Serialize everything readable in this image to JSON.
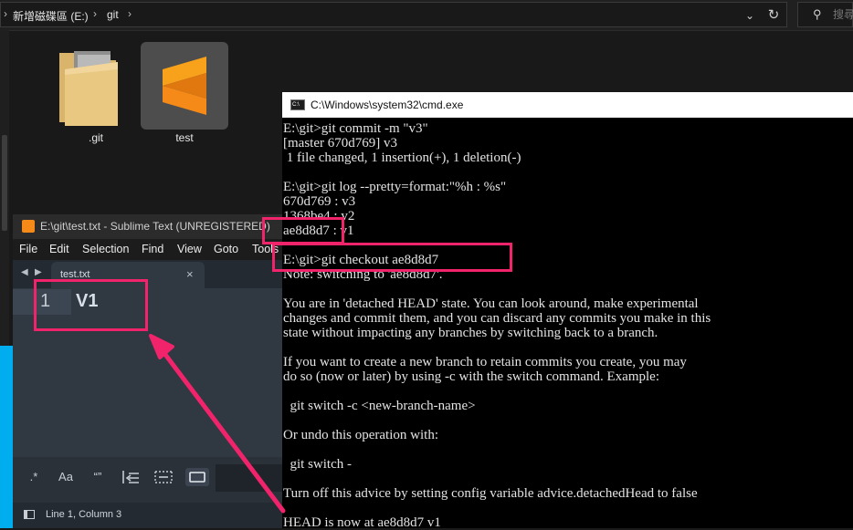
{
  "explorer": {
    "breadcrumb": [
      "新增磁碟區 (E:)",
      "git"
    ],
    "search_placeholder": "搜尋",
    "items": [
      {
        "label": ".git",
        "icon": "folder-icon"
      },
      {
        "label": "test",
        "icon": "sublime-text-icon"
      }
    ]
  },
  "sublime": {
    "title": "E:\\git\\test.txt - Sublime Text (UNREGISTERED)",
    "menu": [
      "File",
      "Edit",
      "Selection",
      "Find",
      "View",
      "Goto",
      "Tools"
    ],
    "tab_name": "test.txt",
    "tab_close": "×",
    "line_number": "1",
    "line_text": "V1",
    "find_options": [
      ".*",
      "Aa",
      "“”"
    ],
    "status": "Line 1, Column 3",
    "brand_color": "#f58a18"
  },
  "cmd": {
    "title": "C:\\Windows\\system32\\cmd.exe",
    "lines": [
      "E:\\git>git commit -m \"v3\"",
      "[master 670d769] v3",
      " 1 file changed, 1 insertion(+), 1 deletion(-)",
      "",
      "E:\\git>git log --pretty=format:\"%h : %s\"",
      "670d769 : v3",
      "1368be4 : v2",
      "ae8d8d7 : v1",
      "",
      "E:\\git>git checkout ae8d8d7",
      "Note: switching to 'ae8d8d7'.",
      "",
      "You are in 'detached HEAD' state. You can look around, make experimental",
      "changes and commit them, and you can discard any commits you make in this",
      "state without impacting any branches by switching back to a branch.",
      "",
      "If you want to create a new branch to retain commits you create, you may",
      "do so (now or later) by using -c with the switch command. Example:",
      "",
      "  git switch -c <new-branch-name>",
      "",
      "Or undo this operation with:",
      "",
      "  git switch -",
      "",
      "Turn off this advice by setting config variable advice.detachedHead to false",
      "",
      "HEAD is now at ae8d8d7 v1"
    ]
  },
  "annotation_color": "#f0236b"
}
